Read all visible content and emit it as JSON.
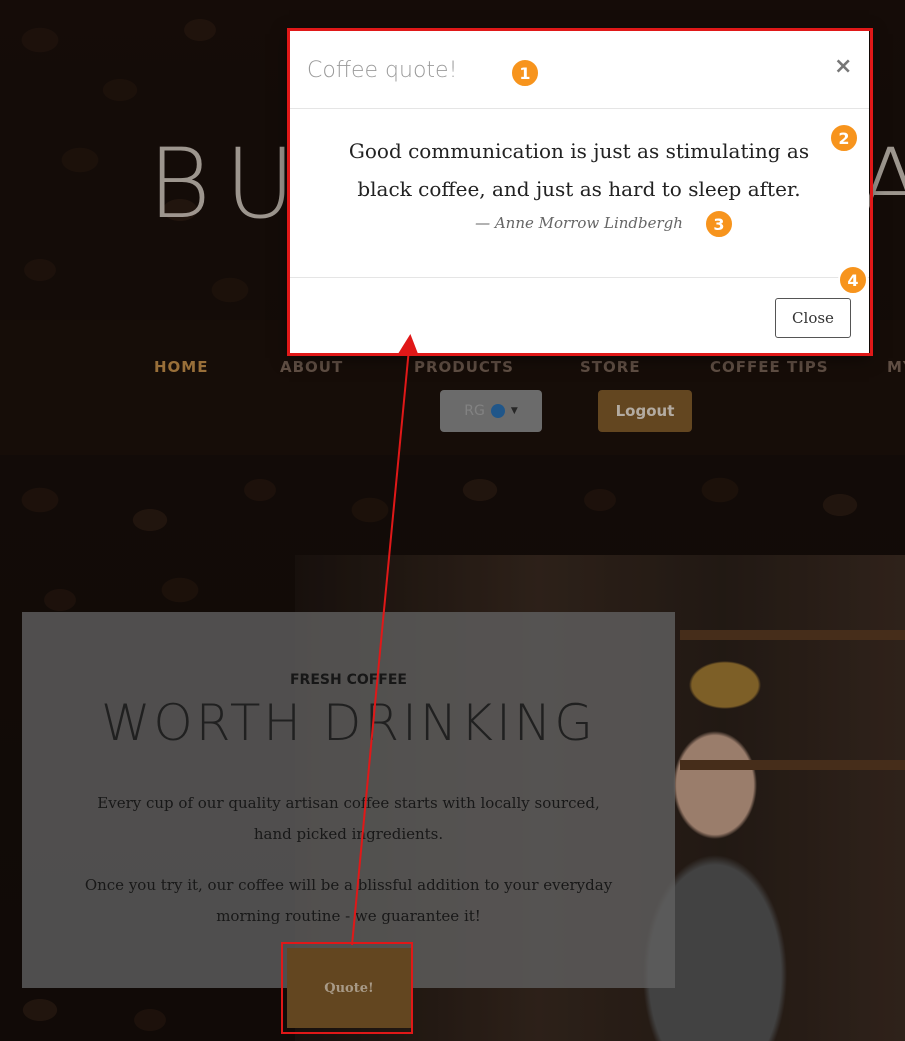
{
  "site": {
    "brand_left": "BU",
    "brand_right": "A"
  },
  "nav": {
    "items": [
      "HOME",
      "ABOUT",
      "PRODUCTS",
      "STORE",
      "COFFEE TIPS",
      "MY"
    ],
    "lang_label": "RG",
    "logout_label": "Logout"
  },
  "hero": {
    "kicker": "FRESH COFFEE",
    "title": "WORTH DRINKING",
    "paragraph1": "Every cup of our quality artisan coffee starts with locally sourced, hand picked ingredients.",
    "paragraph2": "Once you try it, our coffee will be a blissful addition to your everyday morning routine - we guarantee it!",
    "quote_button": "Quote!"
  },
  "modal": {
    "title": "Coffee quote!",
    "close_x": "×",
    "quote_line1": "Good communication is just as stimulating as",
    "quote_line2": "black coffee, and just as hard to sleep after.",
    "author": "— Anne Morrow Lindbergh",
    "close_button": "Close"
  },
  "annotations": {
    "badges": [
      "1",
      "2",
      "3",
      "4"
    ],
    "color": "#e01818",
    "badge_color": "#f7941d"
  }
}
